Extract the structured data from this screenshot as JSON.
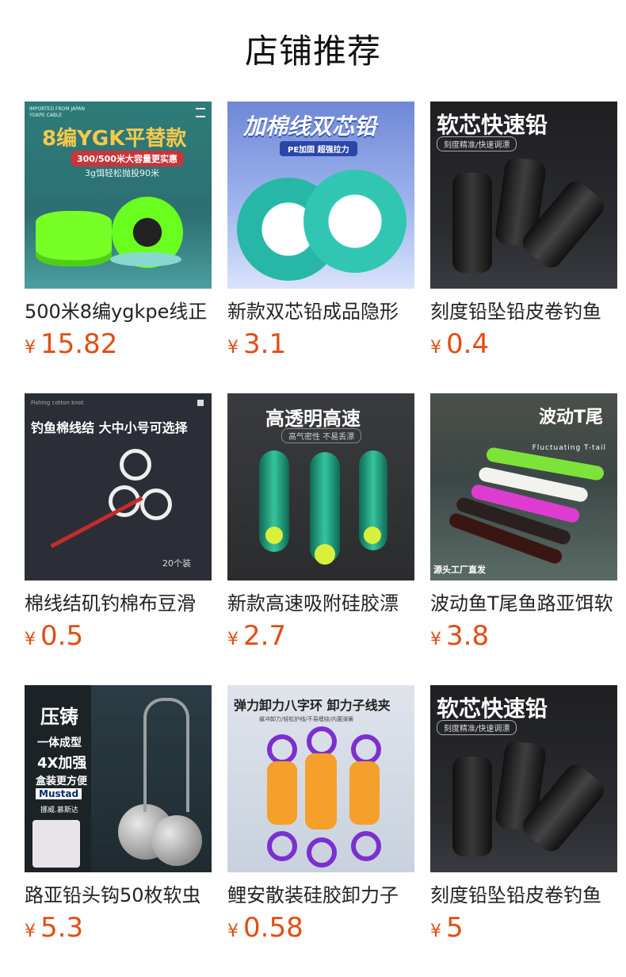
{
  "page": {
    "title": "店铺推荐"
  },
  "products": [
    {
      "name": "500米8编ygkpe线正",
      "currency": "¥",
      "price": "15.82",
      "image_text": {
        "top": "IMPORTED FROM JAPAN",
        "top2": "YGKPE CABLE",
        "headline": "8编YGK平替款",
        "badge": "300/500米大容量更实惠",
        "sub": "3g饵轻松抛投90米"
      }
    },
    {
      "name": "新款双芯铅成品隐形",
      "currency": "¥",
      "price": "3.1",
      "image_text": {
        "headline": "加棉线双芯铅",
        "sub": "PE加固  超强拉力"
      }
    },
    {
      "name": "刻度铅坠铅皮卷钓鱼",
      "currency": "¥",
      "price": "0.4",
      "image_text": {
        "headline": "软芯快速铅",
        "sub": "刻度精准/快速调漂"
      }
    },
    {
      "name": "棉线结矶钓棉布豆滑",
      "currency": "¥",
      "price": "0.5",
      "image_text": {
        "top": "Fishing cotton knot",
        "headline": "钓鱼棉线结 大中小号可选择",
        "count": "20个装"
      }
    },
    {
      "name": "新款高速吸附硅胶漂",
      "currency": "¥",
      "price": "2.7",
      "image_text": {
        "headline": "高透明高速",
        "sub": "高气密性 不易丢漂"
      }
    },
    {
      "name": "波动鱼T尾鱼路亚饵软",
      "currency": "¥",
      "price": "3.8",
      "image_text": {
        "headline": "波动T尾",
        "sub": "Fluctuating T-tail",
        "bottom": "源头工厂直发"
      }
    },
    {
      "name": "路亚铅头钩50枚软虫",
      "currency": "¥",
      "price": "5.3",
      "image_text": {
        "headline": "压铸",
        "l2": "一体成型",
        "l3": "4X加强",
        "l4": "盒装更方便",
        "brand": "Mustad",
        "l5": "挪威.慕斯达"
      }
    },
    {
      "name": "鲤安散装硅胶卸力子",
      "currency": "¥",
      "price": "0.58",
      "image_text": {
        "headline": "弹力卸力八字环 卸力子线夹",
        "sub": "缓冲卸力/轻松护线/不易缠绕/内置弹簧"
      }
    },
    {
      "name": "刻度铅坠铅皮卷钓鱼",
      "currency": "¥",
      "price": "5",
      "image_text": {
        "headline": "软芯快速铅",
        "sub": "刻度精准/快速调漂"
      }
    }
  ]
}
